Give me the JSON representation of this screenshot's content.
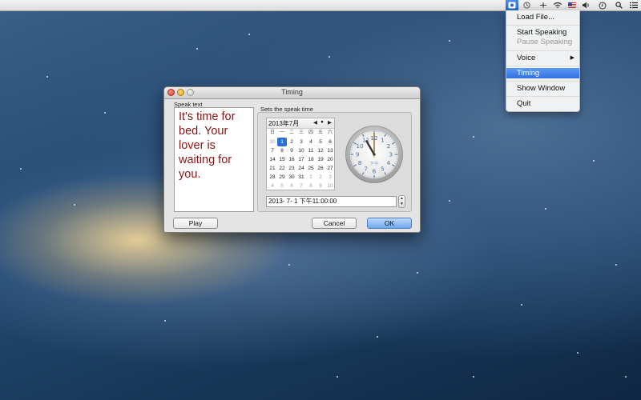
{
  "menubar": {
    "active_icon": "speaker-app-icon",
    "status_icons": [
      "speaker-app-icon",
      "time-machine-icon",
      "bluetooth-icon",
      "wifi-icon",
      "flag-icon",
      "volume-icon",
      "clock-icon",
      "spotlight-icon",
      "notification-list-icon"
    ]
  },
  "menu": {
    "load_file": "Load File...",
    "start_speaking": "Start Speaking",
    "pause_speaking": "Pause Speaking",
    "voice": "Voice",
    "timing": "Timing",
    "show_window": "Show Window",
    "quit": "Quit"
  },
  "window": {
    "title": "Timing",
    "speak_text_label": "Speak text",
    "speak_text": "It's time for bed. Your lover is waiting for you.",
    "speak_time_label": "Sets the speak time",
    "calendar": {
      "month_label": "2013年7月",
      "weekdays": [
        "日",
        "一",
        "二",
        "三",
        "四",
        "五",
        "六"
      ],
      "days": [
        [
          "30",
          "1",
          "2",
          "3",
          "4",
          "5",
          "6"
        ],
        [
          "7",
          "8",
          "9",
          "10",
          "11",
          "12",
          "13"
        ],
        [
          "14",
          "15",
          "16",
          "17",
          "18",
          "19",
          "20"
        ],
        [
          "21",
          "22",
          "23",
          "24",
          "25",
          "26",
          "27"
        ],
        [
          "28",
          "29",
          "30",
          "31",
          "1",
          "2",
          "3"
        ],
        [
          "4",
          "5",
          "6",
          "7",
          "8",
          "9",
          "10"
        ]
      ],
      "selected_day": "1"
    },
    "clock": {
      "pm_label": "下午",
      "hour": 11,
      "minute": 0,
      "numbers": [
        "12",
        "1",
        "2",
        "3",
        "4",
        "5",
        "6",
        "7",
        "8",
        "9",
        "10",
        "11"
      ]
    },
    "datetime_value": "2013- 7- 1 下午11:00:00",
    "play_button": "Play",
    "cancel_button": "Cancel",
    "ok_button": "OK"
  },
  "colors": {
    "speak_text": "#8a1414",
    "menu_highlight": "#2f6fe0",
    "selected_day": "#2a6fd6"
  }
}
